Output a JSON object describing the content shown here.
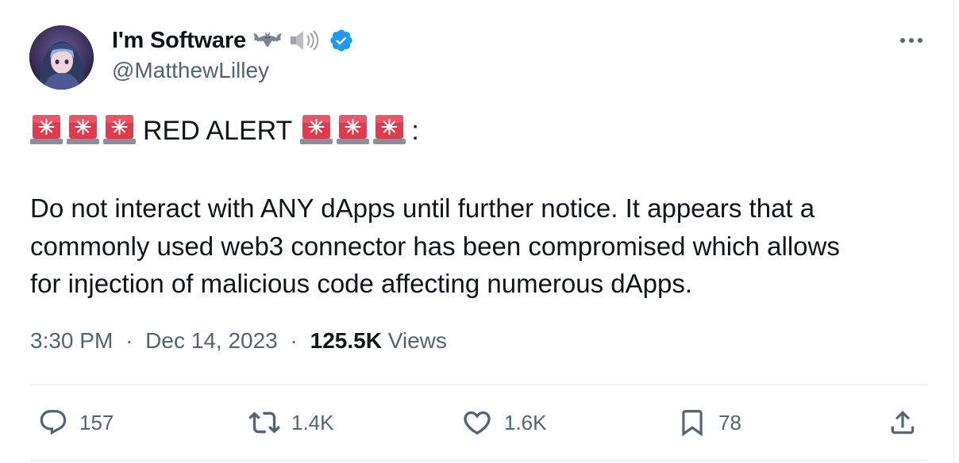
{
  "author": {
    "display_name": "I'm Software",
    "name_emojis": [
      "bat-emoji",
      "speaker-emoji"
    ],
    "verified": true,
    "handle": "@MatthewLilley"
  },
  "tweet": {
    "alert_text": "RED ALERT",
    "alert_suffix": ":",
    "alert_emoji": "police-car-light-emoji",
    "body_lines": [
      "Do not interact with ANY dApps until further notice. It appears that a",
      "commonly used web3 connector has been compromised which allows",
      "for injection of malicious code affecting numerous dApps."
    ],
    "time": "3:30 PM",
    "date": "Dec 14, 2023",
    "separator": "·",
    "views_count": "125.5K",
    "views_label": "Views"
  },
  "actions": {
    "replies": "157",
    "reposts": "1.4K",
    "likes": "1.6K",
    "bookmarks": "78"
  },
  "colors": {
    "text_primary": "#0f1419",
    "text_secondary": "#536471",
    "verified_blue": "#1d9bf0",
    "siren_red": "#e03a4e",
    "divider": "#e7e9ea"
  }
}
